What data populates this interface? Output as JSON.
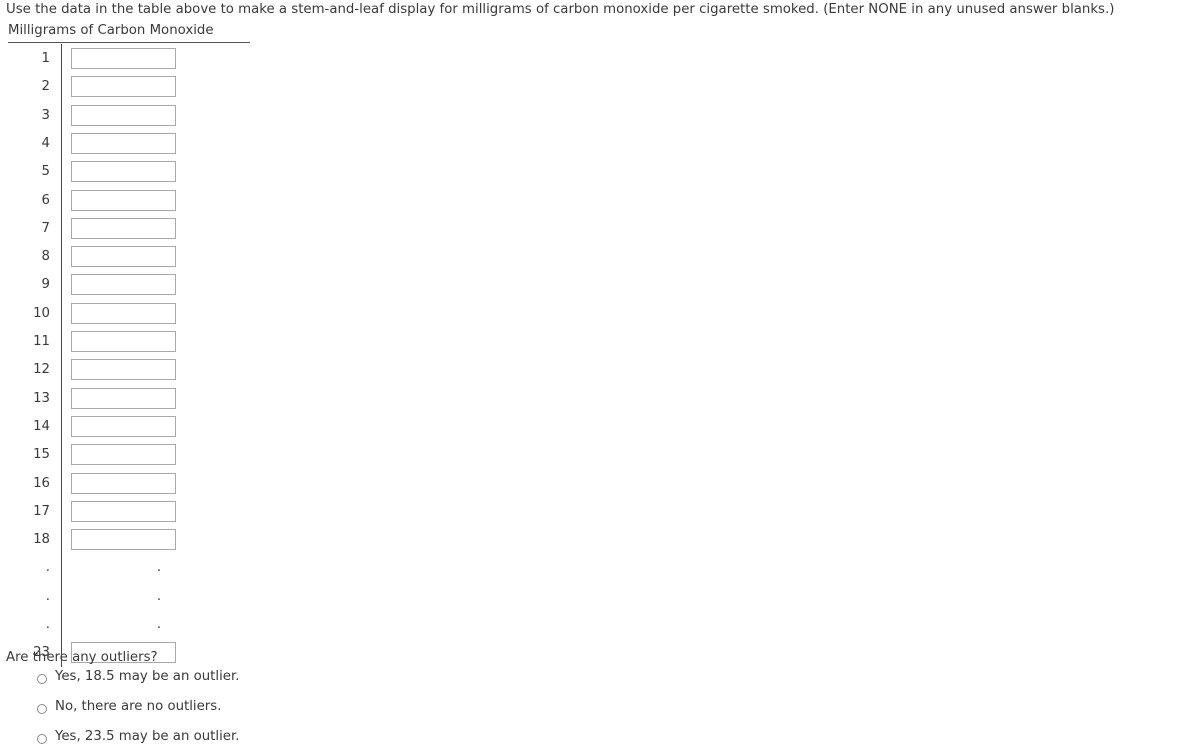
{
  "prompt": "Use the data in the table above to make a stem-and-leaf display for milligrams of carbon monoxide per cigarette smoked. (Enter NONE in any unused answer blanks.)",
  "table": {
    "title": "Milligrams of Carbon Monoxide",
    "rows": [
      {
        "stem": "1",
        "value": "",
        "placeholder": ""
      },
      {
        "stem": "2",
        "value": "",
        "placeholder": ""
      },
      {
        "stem": "3",
        "value": "",
        "placeholder": ""
      },
      {
        "stem": "4",
        "value": "",
        "placeholder": ""
      },
      {
        "stem": "5",
        "value": "",
        "placeholder": ""
      },
      {
        "stem": "6",
        "value": "",
        "placeholder": ""
      },
      {
        "stem": "7",
        "value": "",
        "placeholder": ""
      },
      {
        "stem": "8",
        "value": "",
        "placeholder": ""
      },
      {
        "stem": "9",
        "value": "",
        "placeholder": ""
      },
      {
        "stem": "10",
        "value": "",
        "placeholder": ""
      },
      {
        "stem": "11",
        "value": "",
        "placeholder": ""
      },
      {
        "stem": "12",
        "value": "",
        "placeholder": ""
      },
      {
        "stem": "13",
        "value": "",
        "placeholder": ""
      },
      {
        "stem": "14",
        "value": "",
        "placeholder": ""
      },
      {
        "stem": "15",
        "value": "",
        "placeholder": ""
      },
      {
        "stem": "16",
        "value": "",
        "placeholder": ""
      },
      {
        "stem": "17",
        "value": "",
        "placeholder": ""
      },
      {
        "stem": "18",
        "value": "",
        "placeholder": ""
      }
    ],
    "ellipsis_rows": [
      {
        "left": ".",
        "right": "."
      },
      {
        "left": ".",
        "right": "."
      },
      {
        "left": ".",
        "right": "."
      }
    ],
    "last_row": {
      "stem": "23",
      "value": "",
      "placeholder": ""
    }
  },
  "outlier": {
    "question": "Are there any outliers?",
    "options": [
      {
        "label": "Yes, 18.5 may be an outlier.",
        "selected": false
      },
      {
        "label": "No, there are no outliers.",
        "selected": false
      },
      {
        "label": "Yes, 23.5 may be an outlier.",
        "selected": false
      }
    ]
  },
  "colors": {
    "text": "#3a3a3a",
    "rule": "#555555",
    "divider": "#4a4a4a",
    "input_border": "#a8a8a8",
    "radio_border": "#8a8a8a",
    "background": "#ffffff"
  }
}
